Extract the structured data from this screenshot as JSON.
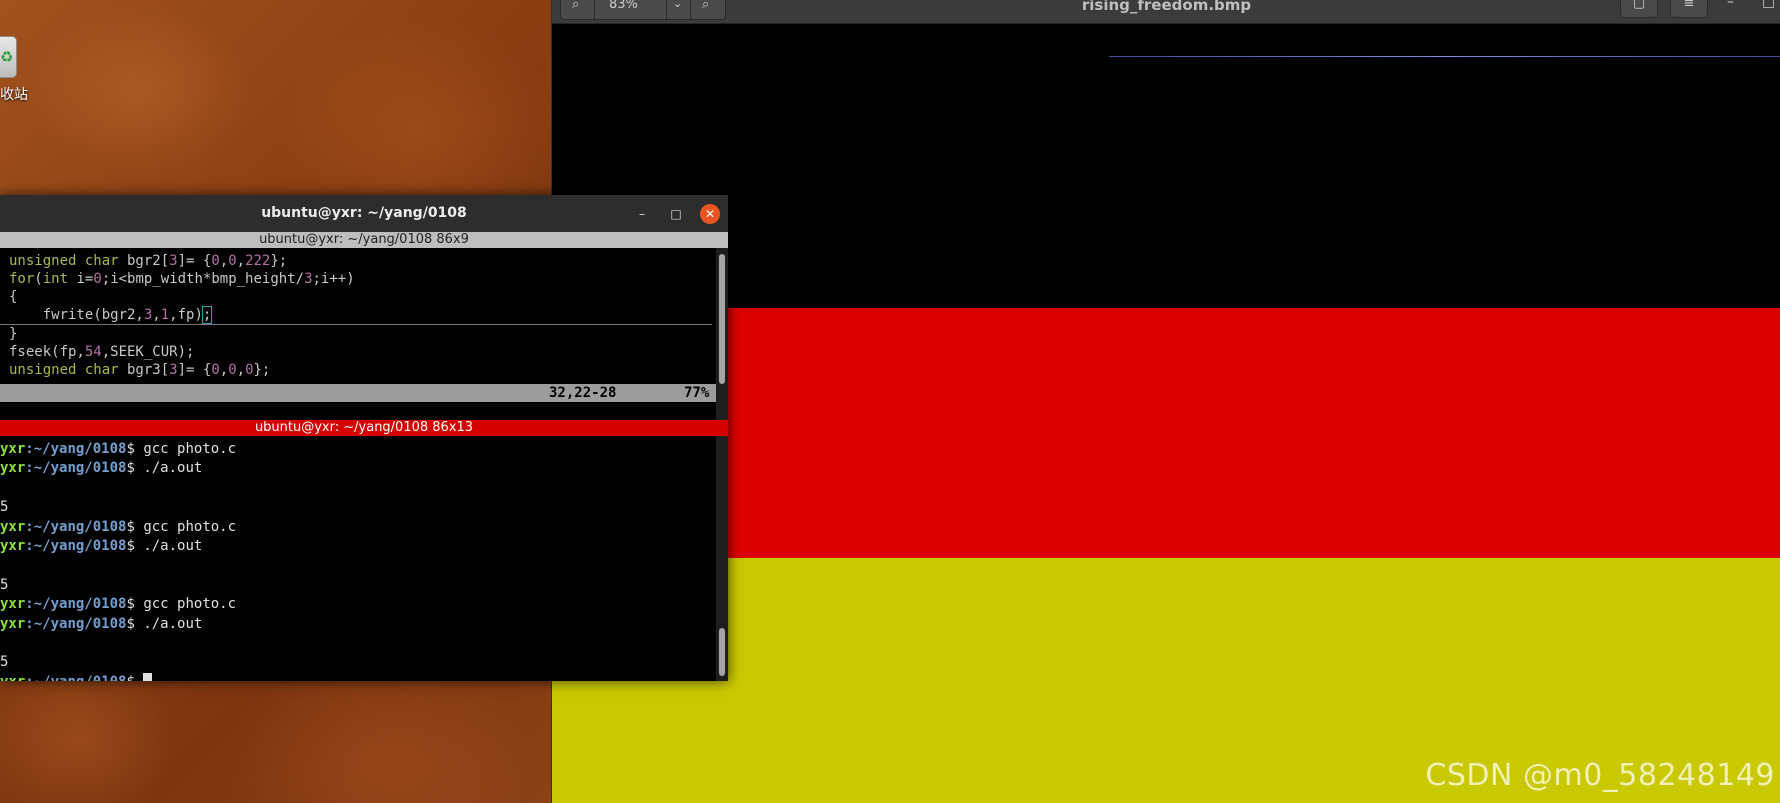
{
  "desktop": {
    "trash_label": "收站"
  },
  "viewer": {
    "zoom": "83%",
    "title": "rising_freedom.bmp",
    "flag_colors": [
      "#000000",
      "#dd0000",
      "#c9c900"
    ],
    "watermark": "CSDN @m0_58248149"
  },
  "terminal": {
    "title": "ubuntu@yxr: ~/yang/0108",
    "top_pane_header": "ubuntu@yxr: ~/yang/0108 86x9",
    "bottom_pane_header": "ubuntu@yxr: ~/yang/0108 86x13",
    "vim": {
      "lines": [
        "unsigned char bgr2[3]= {0,0,222};",
        "for(int i=0;i<bmp_width*bmp_height/3;i++)",
        "{",
        "    fwrite(bgr2,3,1,fp);",
        "}",
        "fseek(fp,54,SEEK_CUR);",
        "unsigned char bgr3[3]= {0,0,0};"
      ],
      "status_position": "32,22-28",
      "status_percent": "77%"
    },
    "shell": {
      "user": "yxr",
      "path": ":~/yang/0108",
      "prompt_symbol": "$ ",
      "lines": [
        {
          "type": "cmd",
          "text": "gcc photo.c"
        },
        {
          "type": "cmd",
          "text": "./a.out"
        },
        {
          "type": "out",
          "text": ""
        },
        {
          "type": "out",
          "text": "5"
        },
        {
          "type": "cmd",
          "text": "gcc photo.c"
        },
        {
          "type": "cmd",
          "text": "./a.out"
        },
        {
          "type": "out",
          "text": ""
        },
        {
          "type": "out",
          "text": "5"
        },
        {
          "type": "cmd",
          "text": "gcc photo.c"
        },
        {
          "type": "cmd",
          "text": "./a.out"
        },
        {
          "type": "out",
          "text": ""
        },
        {
          "type": "out",
          "text": "5"
        },
        {
          "type": "cmd",
          "text": ""
        }
      ]
    }
  }
}
